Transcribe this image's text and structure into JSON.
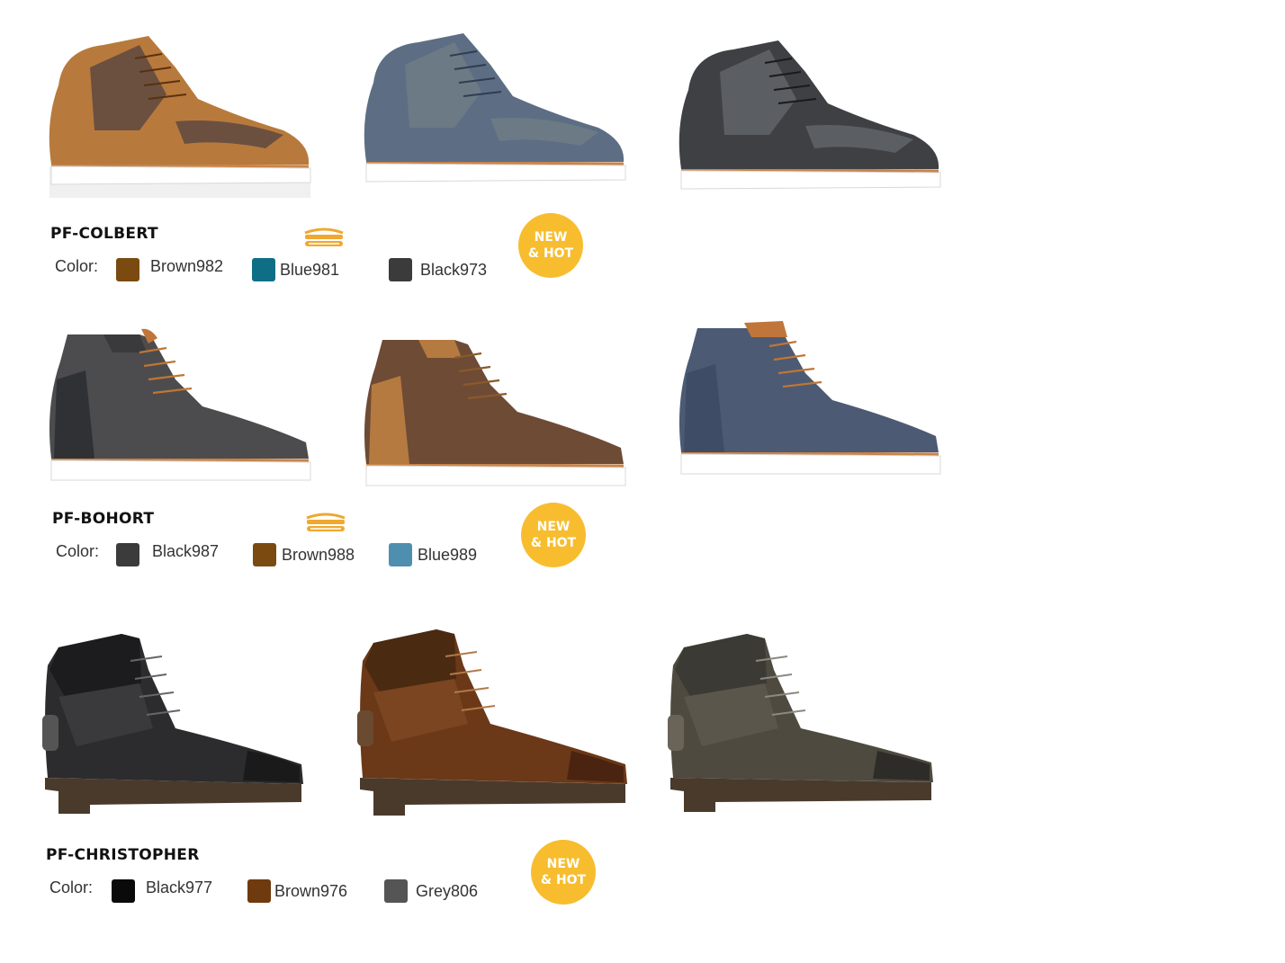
{
  "color_label": "Color:",
  "badge": {
    "line1": "NEW",
    "line2": "& HOT",
    "color": "#f7bd2e"
  },
  "products": [
    {
      "model": "PF-COLBERT",
      "has_sole_icon": true,
      "colors": [
        {
          "name": "Brown982",
          "hex": "#7a4a10"
        },
        {
          "name": "Blue981",
          "hex": "#0e6e86"
        },
        {
          "name": "Black973",
          "hex": "#3b3b3b"
        }
      ],
      "images": [
        "brown-chukka-sneaker-icon",
        "blue-chukka-sneaker-icon",
        "black-chukka-sneaker-icon"
      ]
    },
    {
      "model": "PF-BOHORT",
      "has_sole_icon": true,
      "colors": [
        {
          "name": "Black987",
          "hex": "#3b3b3b"
        },
        {
          "name": "Brown988",
          "hex": "#7a4a10"
        },
        {
          "name": "Blue989",
          "hex": "#4e8fb0"
        }
      ],
      "images": [
        "black-knit-boot-icon",
        "brown-knit-boot-icon",
        "blue-knit-boot-icon"
      ]
    },
    {
      "model": "PF-CHRISTOPHER",
      "has_sole_icon": false,
      "colors": [
        {
          "name": "Black977",
          "hex": "#0a0a0a"
        },
        {
          "name": "Brown976",
          "hex": "#6e3a0e"
        },
        {
          "name": "Grey806",
          "hex": "#555555"
        }
      ],
      "images": [
        "black-leather-boot-icon",
        "brown-leather-boot-icon",
        "grey-leather-boot-icon"
      ]
    }
  ]
}
